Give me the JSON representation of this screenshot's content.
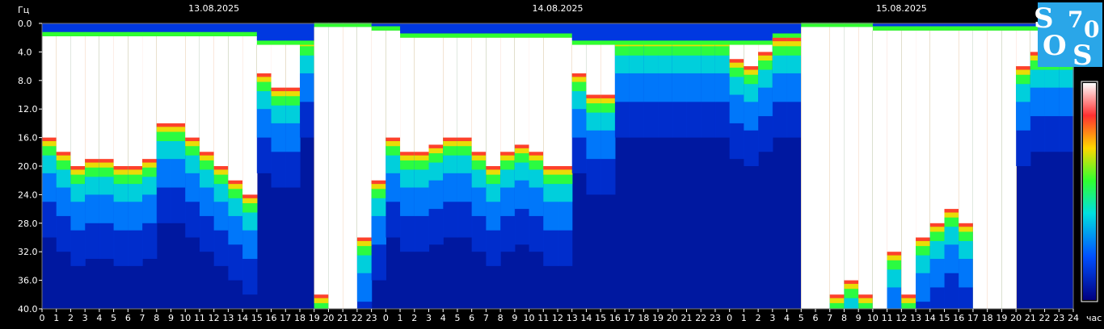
{
  "chart_data": {
    "type": "heatmap",
    "ylabel": "Гц",
    "xlabel": "час",
    "ylim": [
      0,
      40
    ],
    "y_ticks": [
      "0.0",
      "4.0",
      "8.0",
      "12.0",
      "16.0",
      "20.0",
      "24.0",
      "28.0",
      "32.0",
      "36.0",
      "40.0"
    ],
    "x_ticks": [
      "0",
      "1",
      "2",
      "3",
      "4",
      "5",
      "6",
      "7",
      "8",
      "9",
      "10",
      "11",
      "12",
      "13",
      "14",
      "15",
      "16",
      "17",
      "18",
      "19",
      "20",
      "21",
      "22",
      "23",
      "0",
      "1",
      "2",
      "3",
      "4",
      "5",
      "6",
      "7",
      "8",
      "9",
      "10",
      "11",
      "12",
      "13",
      "14",
      "15",
      "16",
      "17",
      "18",
      "19",
      "20",
      "21",
      "22",
      "23",
      "0",
      "1",
      "2",
      "3",
      "4",
      "5",
      "6",
      "7",
      "8",
      "9",
      "10",
      "11",
      "12",
      "13",
      "14",
      "15",
      "16",
      "17",
      "18",
      "19",
      "20",
      "21",
      "22",
      "23",
      "24"
    ],
    "dates": [
      {
        "label": "13.08.2025",
        "hour": 12
      },
      {
        "label": "14.08.2025",
        "hour": 36
      },
      {
        "label": "15.08.2025",
        "hour": 60
      }
    ],
    "xlim": [
      0,
      72
    ],
    "intensity_hours": [
      0,
      1,
      2,
      3,
      4,
      5,
      6,
      7,
      8,
      9,
      10,
      11,
      12,
      13,
      14,
      15,
      16,
      17,
      18,
      19,
      20,
      21,
      22,
      23,
      24,
      25,
      26,
      27,
      28,
      29,
      30,
      31,
      32,
      33,
      34,
      35,
      36,
      37,
      38,
      39,
      40,
      41,
      42,
      43,
      44,
      45,
      46,
      47,
      48,
      49,
      50,
      51,
      52,
      53,
      54,
      55,
      56,
      57,
      58,
      59,
      60,
      61,
      62,
      63,
      64,
      65,
      66,
      67,
      68,
      69,
      70,
      71
    ],
    "white_band_top_hz": [
      1.8,
      1.8,
      1.8,
      1.8,
      1.8,
      1.8,
      1.8,
      1.8,
      1.8,
      1.8,
      1.8,
      1.8,
      1.8,
      1.8,
      1.8,
      3,
      3,
      3,
      3,
      0.5,
      0.5,
      0.5,
      0.5,
      1,
      1,
      2,
      2,
      2,
      2,
      2,
      2,
      2,
      2,
      2,
      2,
      2,
      2,
      3,
      3,
      3,
      3,
      3,
      3,
      3,
      3,
      3,
      3,
      3,
      3,
      3,
      3,
      2,
      2,
      0.5,
      0.5,
      0.5,
      0.5,
      0.5,
      1,
      1,
      1,
      1,
      1,
      1,
      1,
      1,
      1,
      1,
      1,
      1,
      1,
      1,
      2
    ],
    "white_band_bottom_hz": [
      16,
      18,
      20,
      19,
      19,
      20,
      20,
      19,
      14,
      14,
      16,
      18,
      20,
      22,
      24,
      7,
      9,
      9,
      2,
      38,
      40,
      40,
      30,
      22,
      16,
      18,
      18,
      17,
      16,
      16,
      18,
      20,
      18,
      17,
      18,
      20,
      20,
      7,
      10,
      10,
      2,
      2,
      2,
      2,
      2,
      2,
      2,
      2,
      5,
      6,
      4,
      2,
      2,
      40,
      40,
      38,
      36,
      38,
      40,
      32,
      38,
      30,
      28,
      26,
      28,
      40,
      40,
      40,
      6,
      4,
      4,
      4
    ]
  },
  "logo": {
    "letters": [
      "S",
      "7",
      "0",
      "O",
      "S"
    ]
  }
}
